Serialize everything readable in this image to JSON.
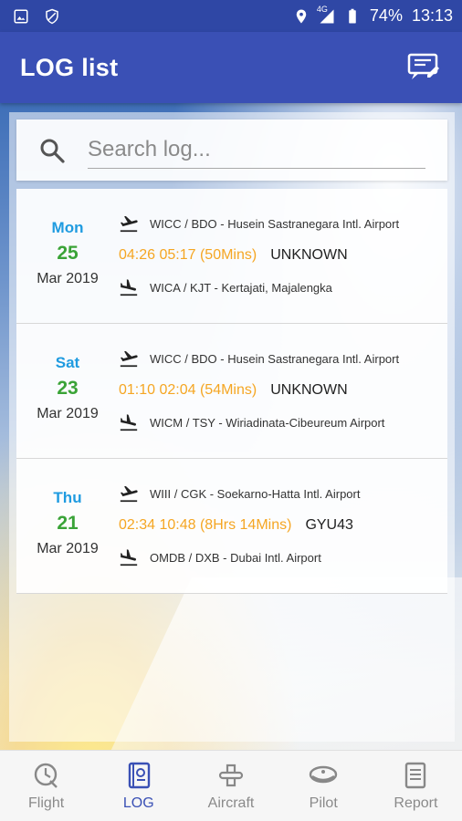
{
  "status": {
    "battery": "74%",
    "time": "13:13",
    "network": "4G"
  },
  "appbar": {
    "title": "LOG list",
    "action_icon": "report-edit-icon"
  },
  "search": {
    "placeholder": "Search log...",
    "value": ""
  },
  "logs": [
    {
      "dow": "Mon",
      "day": "25",
      "month_year": "Mar 2019",
      "departure": "WICC / BDO - Husein Sastranegara Intl. Airport",
      "times": "04:26 05:17 (50Mins)",
      "registration": "UNKNOWN",
      "arrival": "WICA / KJT - Kertajati, Majalengka"
    },
    {
      "dow": "Sat",
      "day": "23",
      "month_year": "Mar 2019",
      "departure": "WICC / BDO - Husein Sastranegara Intl. Airport",
      "times": "01:10 02:04 (54Mins)",
      "registration": "UNKNOWN",
      "arrival": "WICM / TSY - Wiriadinata-Cibeureum Airport"
    },
    {
      "dow": "Thu",
      "day": "21",
      "month_year": "Mar 2019",
      "departure": "WIII / CGK - Soekarno-Hatta Intl. Airport",
      "times": "02:34 10:48 (8Hrs 14Mins)",
      "registration": "GYU43",
      "arrival": "OMDB / DXB - Dubai Intl. Airport"
    }
  ],
  "nav": [
    {
      "label": "Flight",
      "icon": "flight-clock-icon",
      "active": false
    },
    {
      "label": "LOG",
      "icon": "logbook-icon",
      "active": true
    },
    {
      "label": "Aircraft",
      "icon": "aircraft-icon",
      "active": false
    },
    {
      "label": "Pilot",
      "icon": "pilot-cap-icon",
      "active": false
    },
    {
      "label": "Report",
      "icon": "report-icon",
      "active": false
    }
  ],
  "colors": {
    "primary": "#3a50b5",
    "statusbar": "#2f47a5",
    "dow": "#1f9be0",
    "day": "#3aa337",
    "times": "#f5a623"
  }
}
